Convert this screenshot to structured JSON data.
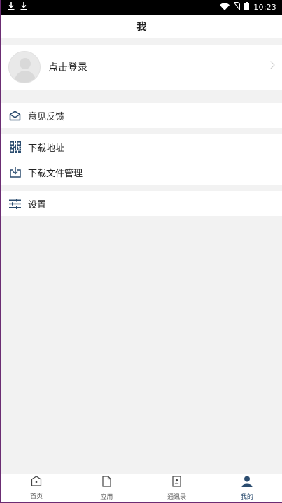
{
  "status_bar": {
    "time": "10:23",
    "left_icons": [
      "download-icon",
      "download-icon"
    ],
    "right_icons": [
      "wifi-icon",
      "no-sim-icon",
      "battery-icon"
    ]
  },
  "header": {
    "title": "我"
  },
  "profile": {
    "login_label": "点击登录"
  },
  "menu": [
    {
      "label": "意见反馈",
      "icon": "feedback-envelope-icon"
    },
    {
      "label": "下载地址",
      "icon": "qrcode-icon"
    },
    {
      "label": "下载文件管理",
      "icon": "download-box-icon"
    },
    {
      "label": "设置",
      "icon": "settings-sliders-icon"
    }
  ],
  "tabbar": {
    "tabs": [
      {
        "label": "首页",
        "icon": "home-icon",
        "active": false
      },
      {
        "label": "应用",
        "icon": "document-icon",
        "active": false
      },
      {
        "label": "通讯录",
        "icon": "contacts-icon",
        "active": false
      },
      {
        "label": "我的",
        "icon": "user-icon",
        "active": true
      }
    ]
  },
  "colors": {
    "accent": "#2b4c6f",
    "page_background": "#f2f2f2",
    "frame_border": "#6b2d73"
  }
}
